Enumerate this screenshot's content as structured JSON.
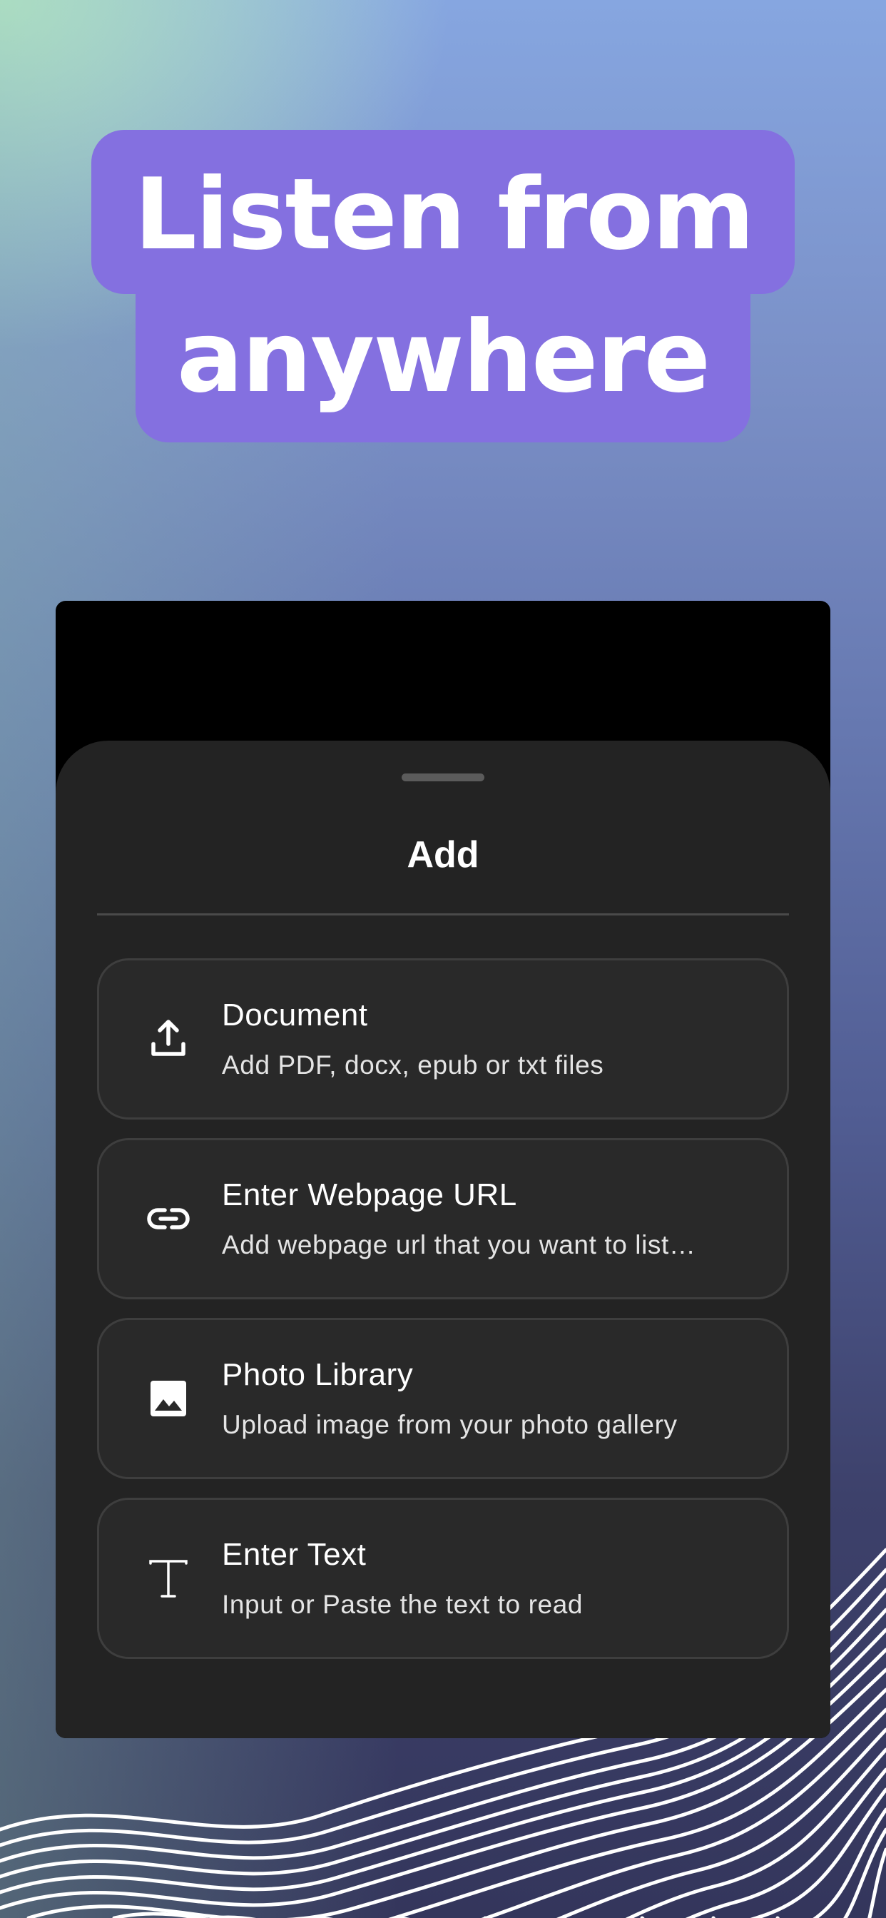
{
  "headline": {
    "line1": "Listen from",
    "line2": "anywhere"
  },
  "sheet": {
    "title": "Add",
    "options": [
      {
        "title": "Document",
        "subtitle": "Add PDF, docx, epub or txt files",
        "icon": "upload-icon"
      },
      {
        "title": "Enter Webpage URL",
        "subtitle": "Add webpage url that you want to list…",
        "icon": "link-icon"
      },
      {
        "title": "Photo Library",
        "subtitle": "Upload image from your photo gallery",
        "icon": "image-icon"
      },
      {
        "title": "Enter Text",
        "subtitle": "Input or Paste the text to read",
        "icon": "text-icon"
      }
    ]
  },
  "colors": {
    "headline_bg": "#8470e0",
    "sheet_bg": "#232323",
    "option_bg": "#292929",
    "option_border": "#3e3e3e"
  }
}
